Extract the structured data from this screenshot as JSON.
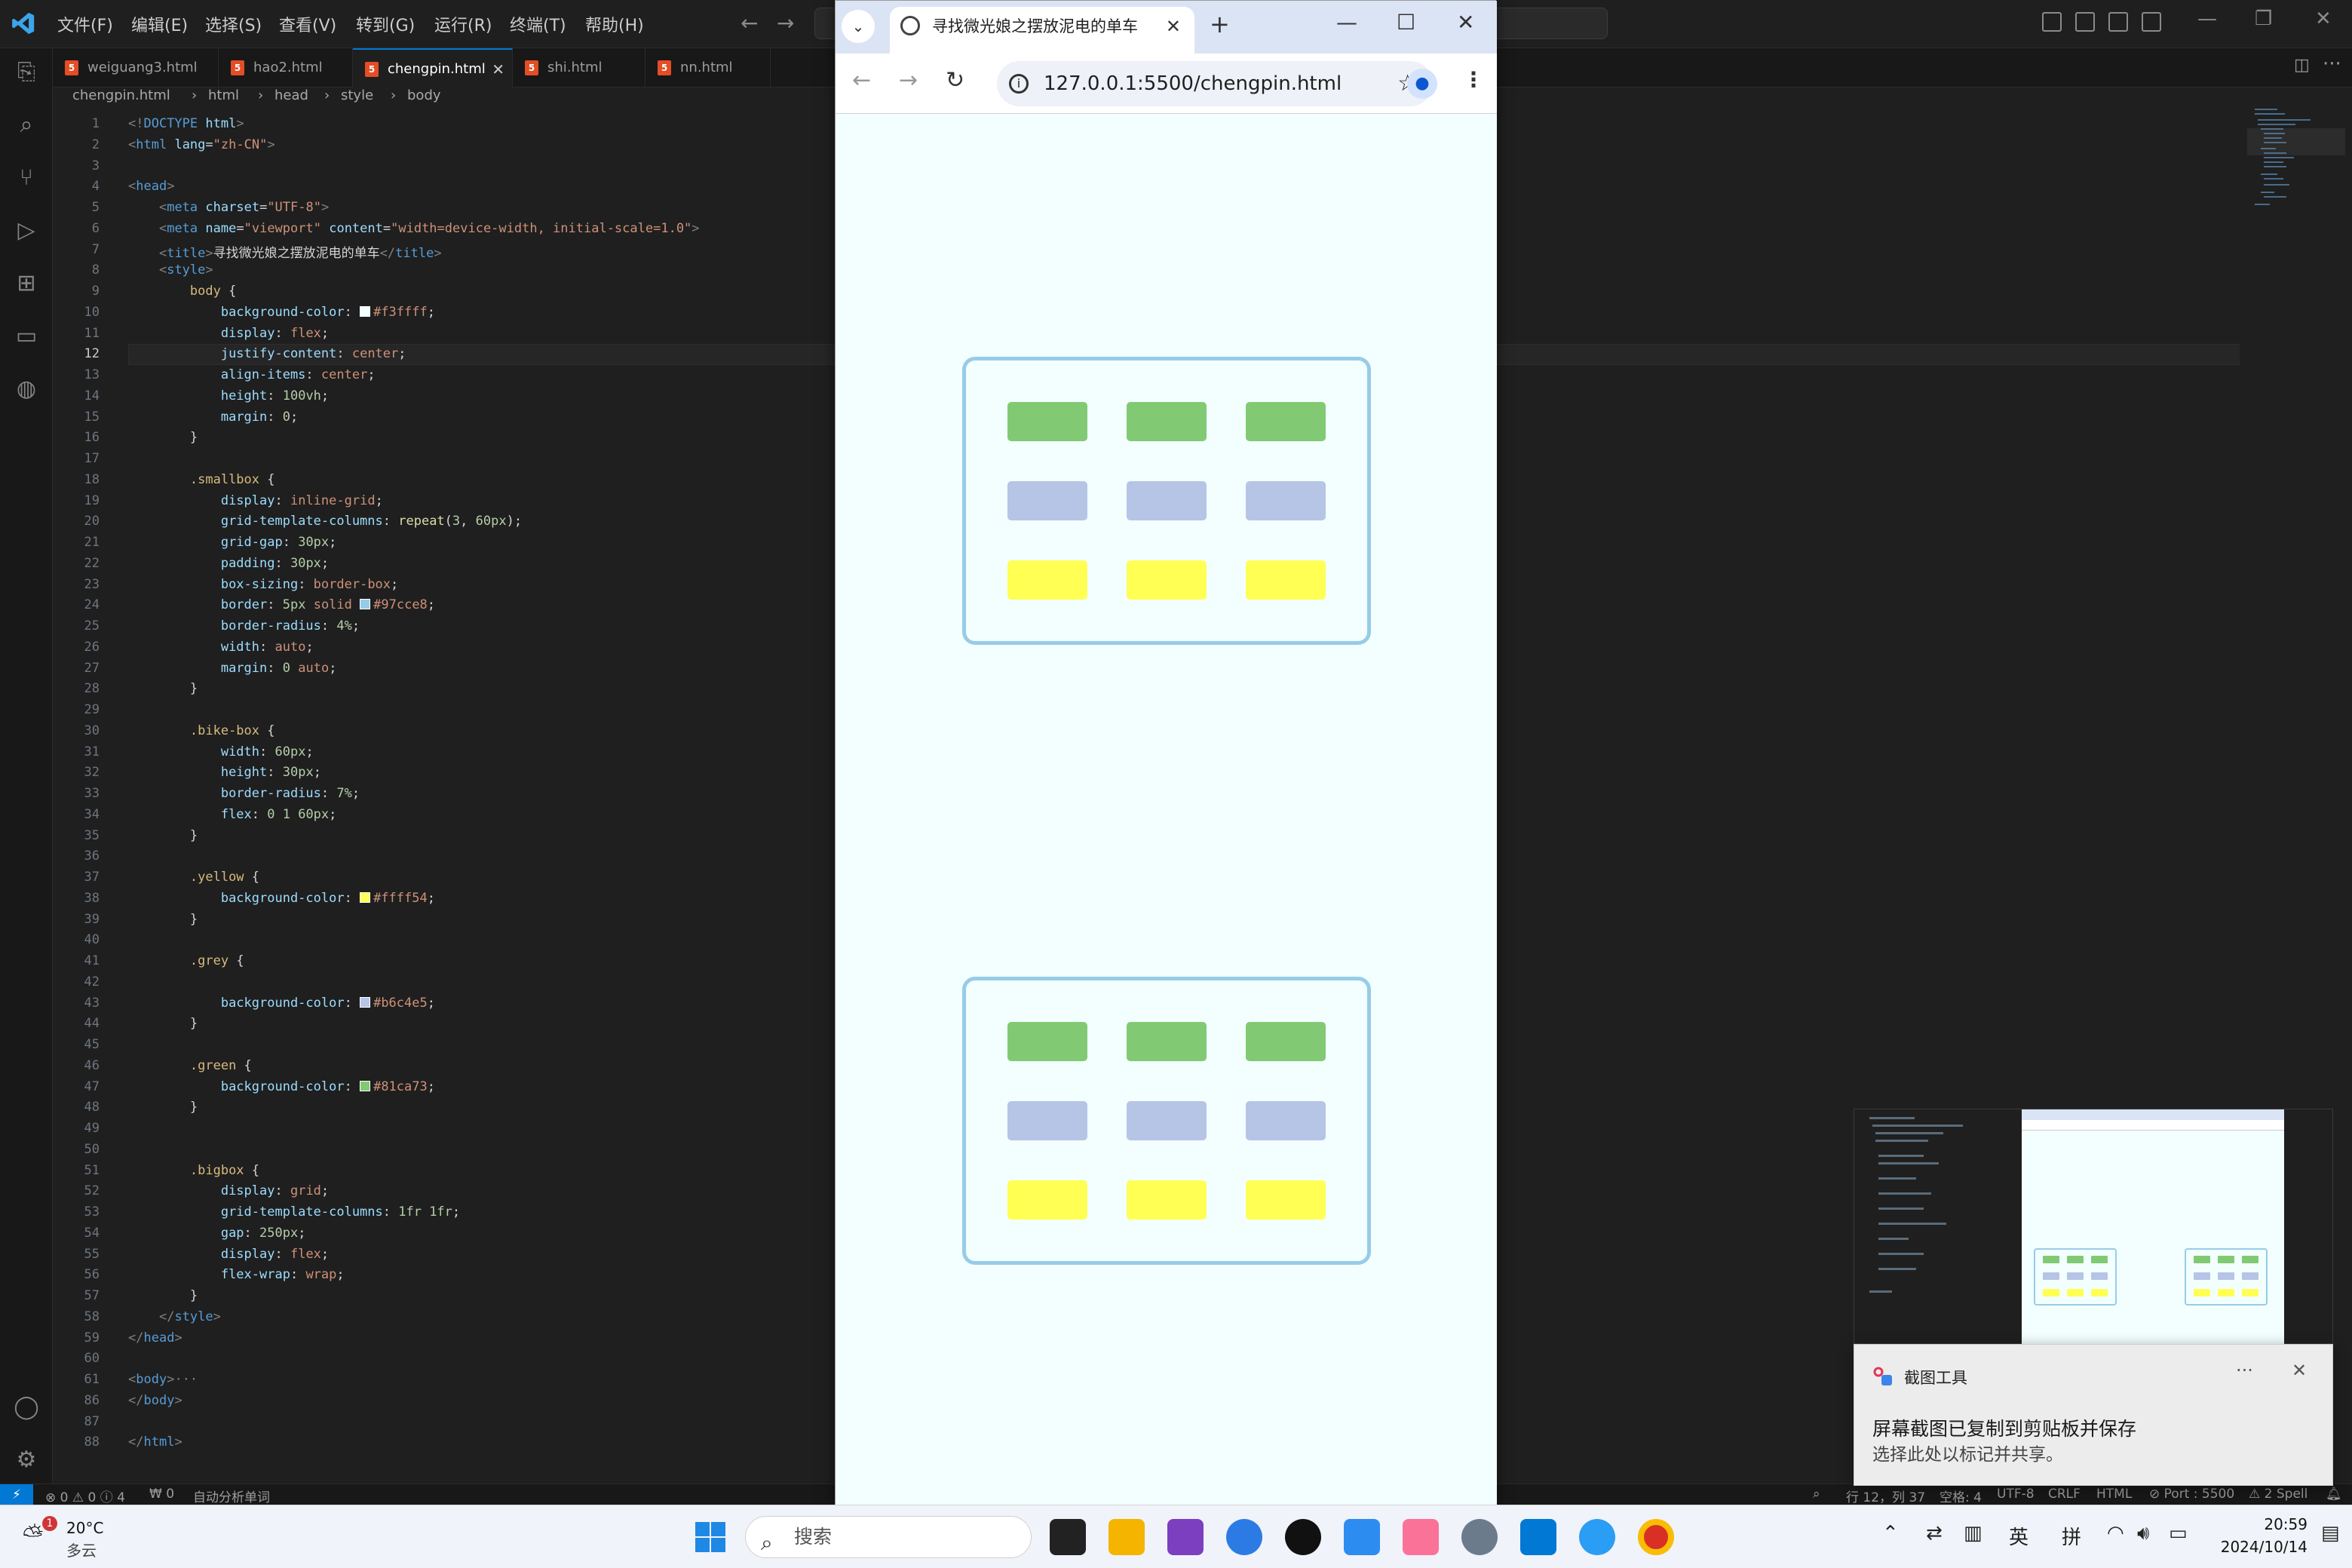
{
  "vscode": {
    "menus": [
      "文件(F)",
      "编辑(E)",
      "选择(S)",
      "查看(V)",
      "转到(G)",
      "运行(R)",
      "终端(T)",
      "帮助(H)"
    ],
    "tabs": [
      {
        "label": "weiguang3.html",
        "active": false
      },
      {
        "label": "hao2.html",
        "active": false
      },
      {
        "label": "chengpin.html",
        "active": true
      },
      {
        "label": "shi.html",
        "active": false
      },
      {
        "label": "nn.html",
        "active": false
      }
    ],
    "breadcrumb": [
      "chengpin.html",
      "html",
      "head",
      "style",
      "body"
    ],
    "current_line": 12,
    "status": {
      "errors": "⊗ 0 ⚠ 0 ⓘ 4",
      "ports": "₩ 0",
      "spell": "自动分析单词",
      "cursor": "行 12，列 37",
      "spaces": "空格: 4",
      "encoding": "UTF-8",
      "eol": "CRLF",
      "language": "HTML",
      "port": "⊘ Port : 5500",
      "spellcount": "⚠ 2 Spell"
    }
  },
  "code_lines": [
    {
      "n": "1",
      "h": "<span class=\"pn\">&lt;!</span><span class=\"tg\">DOCTYPE</span> <span class=\"at\">html</span><span class=\"pn\">&gt;</span>"
    },
    {
      "n": "2",
      "h": "<span class=\"pn\">&lt;</span><span class=\"tg\">html</span> <span class=\"at\">lang</span>=<span class=\"st\">\"zh-CN\"</span><span class=\"pn\">&gt;</span>"
    },
    {
      "n": "3",
      "h": ""
    },
    {
      "n": "4",
      "h": "<span class=\"pn\">&lt;</span><span class=\"tg\">head</span><span class=\"pn\">&gt;</span>"
    },
    {
      "n": "5",
      "h": "    <span class=\"pn\">&lt;</span><span class=\"tg\">meta</span> <span class=\"at\">charset</span>=<span class=\"st\">\"UTF-8\"</span><span class=\"pn\">&gt;</span>"
    },
    {
      "n": "6",
      "h": "    <span class=\"pn\">&lt;</span><span class=\"tg\">meta</span> <span class=\"at\">name</span>=<span class=\"st\">\"viewport\"</span> <span class=\"at\">content</span>=<span class=\"st\">\"width=device-width, initial-scale=1.0\"</span><span class=\"pn\">&gt;</span>"
    },
    {
      "n": "7",
      "h": "    <span class=\"pn\">&lt;</span><span class=\"tg\">title</span><span class=\"pn\">&gt;</span>寻找微光娘之摆放泥电的单车<span class=\"pn\">&lt;/</span><span class=\"tg\">title</span><span class=\"pn\">&gt;</span>"
    },
    {
      "n": "8",
      "h": "    <span class=\"pn\">&lt;</span><span class=\"tg\">style</span><span class=\"pn\">&gt;</span>"
    },
    {
      "n": "9",
      "h": "        <span class=\"sel\">body</span> {"
    },
    {
      "n": "10",
      "h": "            <span class=\"pr\">background-color</span>: <span class=\"sw\" style=\"background:#f3ffff\"></span><span class=\"vl\">#f3ffff</span>;"
    },
    {
      "n": "11",
      "h": "            <span class=\"pr\">display</span>: <span class=\"vl\">flex</span>;"
    },
    {
      "n": "12",
      "h": "            <span class=\"pr\">justify-content</span>: <span class=\"vl\">center</span>;"
    },
    {
      "n": "13",
      "h": "            <span class=\"pr\">align-items</span>: <span class=\"vl\">center</span>;"
    },
    {
      "n": "14",
      "h": "            <span class=\"pr\">height</span>: <span class=\"nm\">100vh</span>;"
    },
    {
      "n": "15",
      "h": "            <span class=\"pr\">margin</span>: <span class=\"nm\">0</span>;"
    },
    {
      "n": "16",
      "h": "        }"
    },
    {
      "n": "17",
      "h": ""
    },
    {
      "n": "18",
      "h": "        <span class=\"sel\">.smallbox</span> {"
    },
    {
      "n": "19",
      "h": "            <span class=\"pr\">display</span>: <span class=\"vl\">inline-grid</span>;"
    },
    {
      "n": "20",
      "h": "            <span class=\"pr\">grid-template-columns</span>: <span class=\"fn\">repeat</span>(<span class=\"nm\">3</span>, <span class=\"nm\">60px</span>);"
    },
    {
      "n": "21",
      "h": "            <span class=\"pr\">grid-gap</span>: <span class=\"nm\">30px</span>;"
    },
    {
      "n": "22",
      "h": "            <span class=\"pr\">padding</span>: <span class=\"nm\">30px</span>;"
    },
    {
      "n": "23",
      "h": "            <span class=\"pr\">box-sizing</span>: <span class=\"vl\">border-box</span>;"
    },
    {
      "n": "24",
      "h": "            <span class=\"pr\">border</span>: <span class=\"nm\">5px</span> <span class=\"vl\">solid</span> <span class=\"sw\" style=\"background:#97cce8\"></span><span class=\"vl\">#97cce8</span>;"
    },
    {
      "n": "25",
      "h": "            <span class=\"pr\">border-radius</span>: <span class=\"nm\">4%</span>;"
    },
    {
      "n": "26",
      "h": "            <span class=\"pr\">width</span>: <span class=\"vl\">auto</span>;"
    },
    {
      "n": "27",
      "h": "            <span class=\"pr\">margin</span>: <span class=\"nm\">0</span> <span class=\"vl\">auto</span>;"
    },
    {
      "n": "28",
      "h": "        }"
    },
    {
      "n": "29",
      "h": ""
    },
    {
      "n": "30",
      "h": "        <span class=\"sel\">.bike-box</span> {"
    },
    {
      "n": "31",
      "h": "            <span class=\"pr\">width</span>: <span class=\"nm\">60px</span>;"
    },
    {
      "n": "32",
      "h": "            <span class=\"pr\">height</span>: <span class=\"nm\">30px</span>;"
    },
    {
      "n": "33",
      "h": "            <span class=\"pr\">border-radius</span>: <span class=\"nm\">7%</span>;"
    },
    {
      "n": "34",
      "h": "            <span class=\"pr\">flex</span>: <span class=\"nm\">0 1 60px</span>;"
    },
    {
      "n": "35",
      "h": "        }"
    },
    {
      "n": "36",
      "h": ""
    },
    {
      "n": "37",
      "h": "        <span class=\"sel\">.yellow</span> {"
    },
    {
      "n": "38",
      "h": "            <span class=\"pr\">background-color</span>: <span class=\"sw\" style=\"background:#ffff54\"></span><span class=\"vl\">#ffff54</span>;"
    },
    {
      "n": "39",
      "h": "        }"
    },
    {
      "n": "40",
      "h": ""
    },
    {
      "n": "41",
      "h": "        <span class=\"sel\">.grey</span> {"
    },
    {
      "n": "42",
      "h": ""
    },
    {
      "n": "43",
      "h": "            <span class=\"pr\">background-color</span>: <span class=\"sw\" style=\"background:#b6c4e5\"></span><span class=\"vl\">#b6c4e5</span>;"
    },
    {
      "n": "44",
      "h": "        }"
    },
    {
      "n": "45",
      "h": ""
    },
    {
      "n": "46",
      "h": "        <span class=\"sel\">.green</span> {"
    },
    {
      "n": "47",
      "h": "            <span class=\"pr\">background-color</span>: <span class=\"sw\" style=\"background:#81ca73\"></span><span class=\"vl\">#81ca73</span>;"
    },
    {
      "n": "48",
      "h": "        }"
    },
    {
      "n": "49",
      "h": ""
    },
    {
      "n": "50",
      "h": ""
    },
    {
      "n": "51",
      "h": "        <span class=\"sel\">.bigbox</span> {"
    },
    {
      "n": "52",
      "h": "            <span class=\"pr\">display</span>: <span class=\"vl\">grid</span>;"
    },
    {
      "n": "53",
      "h": "            <span class=\"pr\">grid-template-columns</span>: <span class=\"nm\">1fr 1fr</span>;"
    },
    {
      "n": "54",
      "h": "            <span class=\"pr\">gap</span>: <span class=\"nm\">250px</span>;"
    },
    {
      "n": "55",
      "h": "            <span class=\"pr\">display</span>: <span class=\"vl\">flex</span>;"
    },
    {
      "n": "56",
      "h": "            <span class=\"pr\">flex-wrap</span>: <span class=\"vl\">wrap</span>;"
    },
    {
      "n": "57",
      "h": "        }"
    },
    {
      "n": "58",
      "h": "    <span class=\"pn\">&lt;/</span><span class=\"tg\">style</span><span class=\"pn\">&gt;</span>"
    },
    {
      "n": "59",
      "h": "<span class=\"pn\">&lt;/</span><span class=\"tg\">head</span><span class=\"pn\">&gt;</span>"
    },
    {
      "n": "60",
      "h": ""
    },
    {
      "n": "61",
      "h": "<span class=\"pn\">&lt;</span><span class=\"tg\">body</span><span class=\"pn\">&gt;</span><span class=\"pn\">···</span>"
    },
    {
      "n": "86",
      "h": "<span class=\"pn\">&lt;/</span><span class=\"tg\">body</span><span class=\"pn\">&gt;</span>"
    },
    {
      "n": "87",
      "h": ""
    },
    {
      "n": "88",
      "h": "<span class=\"pn\">&lt;/</span><span class=\"tg\">html</span><span class=\"pn\">&gt;</span>"
    }
  ],
  "browser": {
    "tab_title": "寻找微光娘之摆放泥电的单车",
    "url": "127.0.0.1:5500/chengpin.html",
    "boxes": [
      {
        "rows": [
          "green",
          "grey",
          "yellow"
        ]
      },
      {
        "rows": [
          "green",
          "grey",
          "yellow"
        ]
      }
    ]
  },
  "notification": {
    "app": "截图工具",
    "title": "屏幕截图已复制到剪贴板并保存",
    "body": "选择此处以标记并共享。"
  },
  "taskbar": {
    "weather_temp": "20°C",
    "weather_desc": "多云",
    "weather_badge": "1",
    "search_placeholder": "搜索",
    "ime_lang": "英",
    "ime_mode": "拼",
    "time": "20:59",
    "date": "2024/10/14"
  },
  "colors": {
    "green": "#81ca73",
    "grey": "#b6c4e5",
    "yellow": "#ffff54",
    "border": "#97cce8",
    "page_bg": "#f3ffff"
  }
}
